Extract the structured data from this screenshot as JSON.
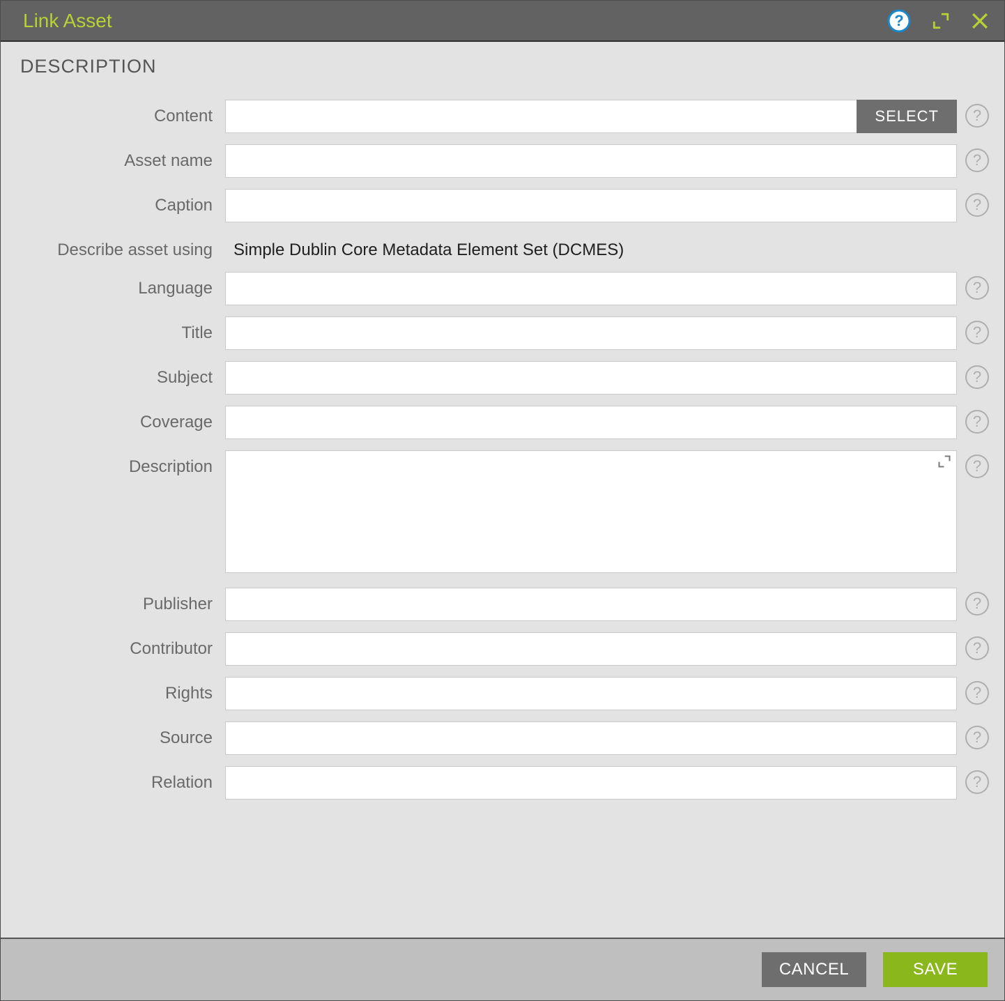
{
  "dialog": {
    "title": "Link Asset",
    "section_header": "DESCRIPTION"
  },
  "form": {
    "content": {
      "label": "Content",
      "value": "",
      "select_button": "SELECT"
    },
    "asset_name": {
      "label": "Asset name",
      "value": ""
    },
    "caption": {
      "label": "Caption",
      "value": ""
    },
    "describe_using": {
      "label": "Describe asset using",
      "value": "Simple Dublin Core Metadata Element Set (DCMES)"
    },
    "language": {
      "label": "Language",
      "value": ""
    },
    "title": {
      "label": "Title",
      "value": ""
    },
    "subject": {
      "label": "Subject",
      "value": ""
    },
    "coverage": {
      "label": "Coverage",
      "value": ""
    },
    "description": {
      "label": "Description",
      "value": ""
    },
    "publisher": {
      "label": "Publisher",
      "value": ""
    },
    "contributor": {
      "label": "Contributor",
      "value": ""
    },
    "rights": {
      "label": "Rights",
      "value": ""
    },
    "source": {
      "label": "Source",
      "value": ""
    },
    "relation": {
      "label": "Relation",
      "value": ""
    }
  },
  "footer": {
    "cancel_label": "CANCEL",
    "save_label": "SAVE"
  }
}
